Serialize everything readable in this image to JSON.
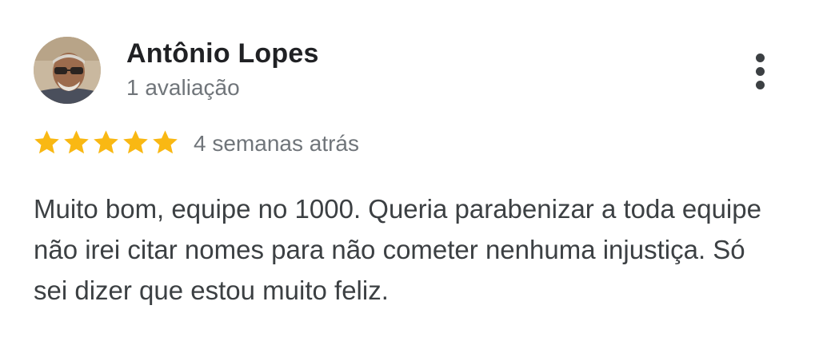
{
  "review": {
    "author_name": "Antônio Lopes",
    "review_count": "1 avaliação",
    "rating": 5,
    "rating_max": 5,
    "date": "4 semanas atrás",
    "text": "Muito bom, equipe no 1000. Queria parabenizar a toda equipe não irei citar nomes para não cometer nenhuma injustiça. Só sei dizer que estou muito feliz.",
    "icons": {
      "more": "more-vert-icon",
      "star": "star-icon"
    }
  },
  "colors": {
    "star": "#f9b813",
    "name": "#202124",
    "secondary": "#70757a",
    "body": "#3c4043"
  }
}
